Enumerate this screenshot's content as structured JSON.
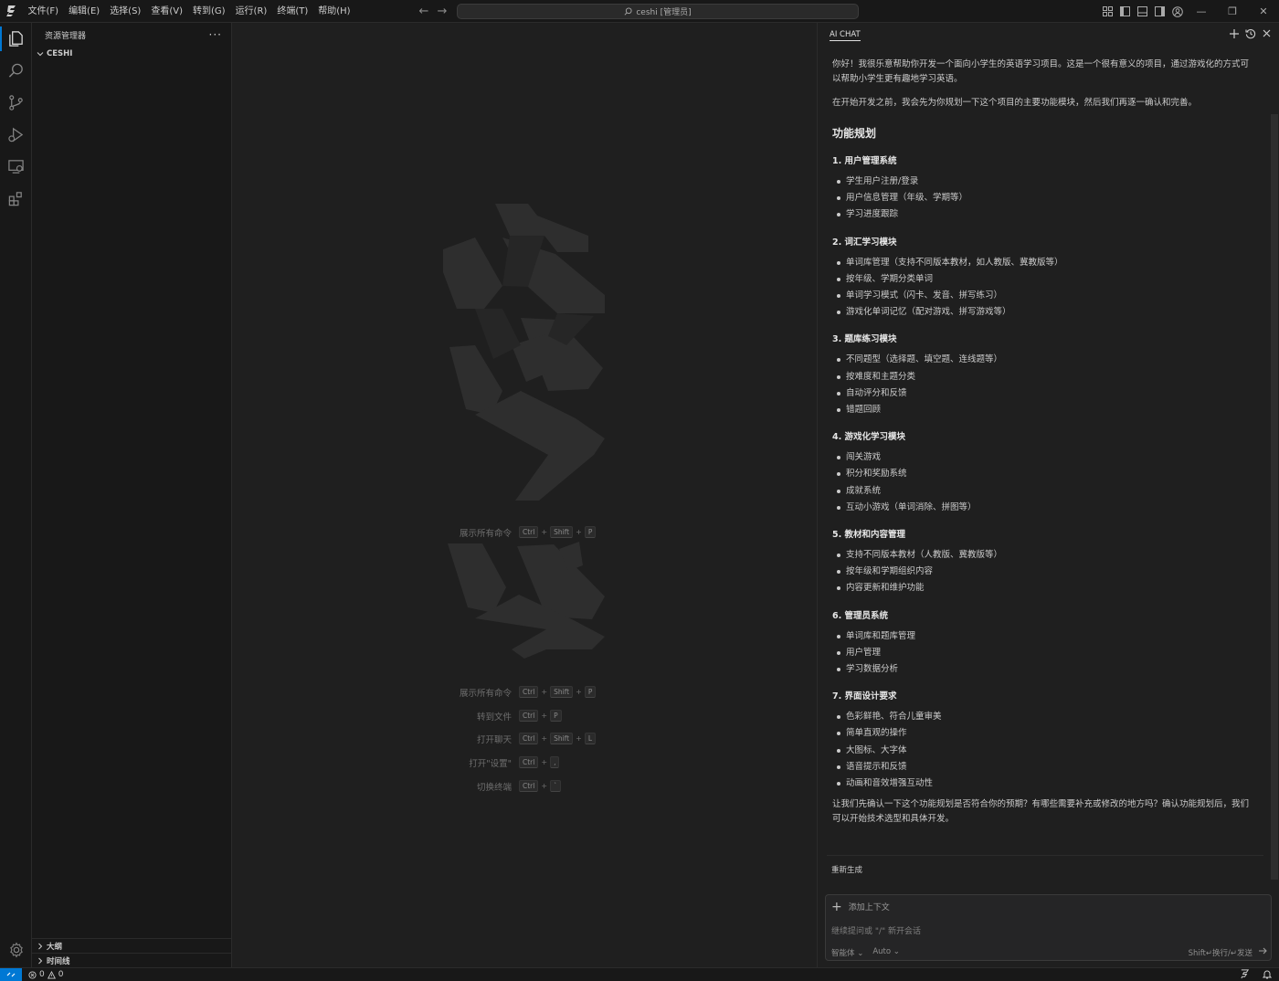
{
  "titlebar": {
    "menu": [
      "文件(F)",
      "编辑(E)",
      "选择(S)",
      "查看(V)",
      "转到(G)",
      "运行(R)",
      "终端(T)",
      "帮助(H)"
    ],
    "search_text": "ceshi [管理员]",
    "minimize": "—",
    "restore": "❐",
    "close": "✕"
  },
  "sidebar": {
    "title": "资源管理器",
    "more": "···",
    "root_folder": "CESHI",
    "outline": "大纲",
    "timeline": "时间线"
  },
  "editor": {
    "shortcuts_top": [
      {
        "label": "展示所有命令",
        "keys": [
          "Ctrl",
          "Shift",
          "P"
        ]
      }
    ],
    "shortcuts": [
      {
        "label": "展示所有命令",
        "keys": [
          "Ctrl",
          "Shift",
          "P"
        ]
      },
      {
        "label": "转到文件",
        "keys": [
          "Ctrl",
          "P"
        ]
      },
      {
        "label": "打开聊天",
        "keys": [
          "Ctrl",
          "Shift",
          "L"
        ]
      },
      {
        "label": "打开\"设置\"",
        "keys": [
          "Ctrl",
          ","
        ]
      },
      {
        "label": "切换终端",
        "keys": [
          "Ctrl",
          "`"
        ]
      }
    ]
  },
  "chat": {
    "tab": "AI CHAT",
    "intro": "你好！我很乐意帮助你开发一个面向小学生的英语学习项目。这是一个很有意义的项目，通过游戏化的方式可以帮助小学生更有趣地学习英语。",
    "intro2": "在开始开发之前，我会先为你规划一下这个项目的主要功能模块，然后我们再逐一确认和完善。",
    "heading": "功能规划",
    "sections": [
      {
        "title": "1. 用户管理系统",
        "items": [
          "学生用户注册/登录",
          "用户信息管理（年级、学期等）",
          "学习进度跟踪"
        ]
      },
      {
        "title": "2. 词汇学习模块",
        "items": [
          "单词库管理（支持不同版本教材，如人教版、冀教版等）",
          "按年级、学期分类单词",
          "单词学习模式（闪卡、发音、拼写练习）",
          "游戏化单词记忆（配对游戏、拼写游戏等）"
        ]
      },
      {
        "title": "3. 题库练习模块",
        "items": [
          "不同题型（选择题、填空题、连线题等）",
          "按难度和主题分类",
          "自动评分和反馈",
          "错题回顾"
        ]
      },
      {
        "title": "4. 游戏化学习模块",
        "items": [
          "闯关游戏",
          "积分和奖励系统",
          "成就系统",
          "互动小游戏（单词消除、拼图等）"
        ]
      },
      {
        "title": "5. 教材和内容管理",
        "items": [
          "支持不同版本教材（人教版、冀教版等）",
          "按年级和学期组织内容",
          "内容更新和维护功能"
        ]
      },
      {
        "title": "6. 管理员系统",
        "items": [
          "单词库和题库管理",
          "用户管理",
          "学习数据分析"
        ]
      },
      {
        "title": "7. 界面设计要求",
        "items": [
          "色彩鲜艳、符合儿童审美",
          "简单直观的操作",
          "大图标、大字体",
          "语音提示和反馈",
          "动画和音效增强互动性"
        ]
      }
    ],
    "closing": "让我们先确认一下这个功能规划是否符合你的预期？有哪些需要补充或修改的地方吗？确认功能规划后，我们可以开始技术选型和具体开发。",
    "regenerate": "重新生成",
    "input": {
      "add_context": "添加上下文",
      "placeholder": "继续提问或 \"/\" 新开会话",
      "mode": "智能体 ⌄",
      "model": "Auto ⌄",
      "hint": "Shift↵换行/↵发送"
    }
  },
  "statusbar": {
    "errors": "0",
    "warnings": "0"
  }
}
